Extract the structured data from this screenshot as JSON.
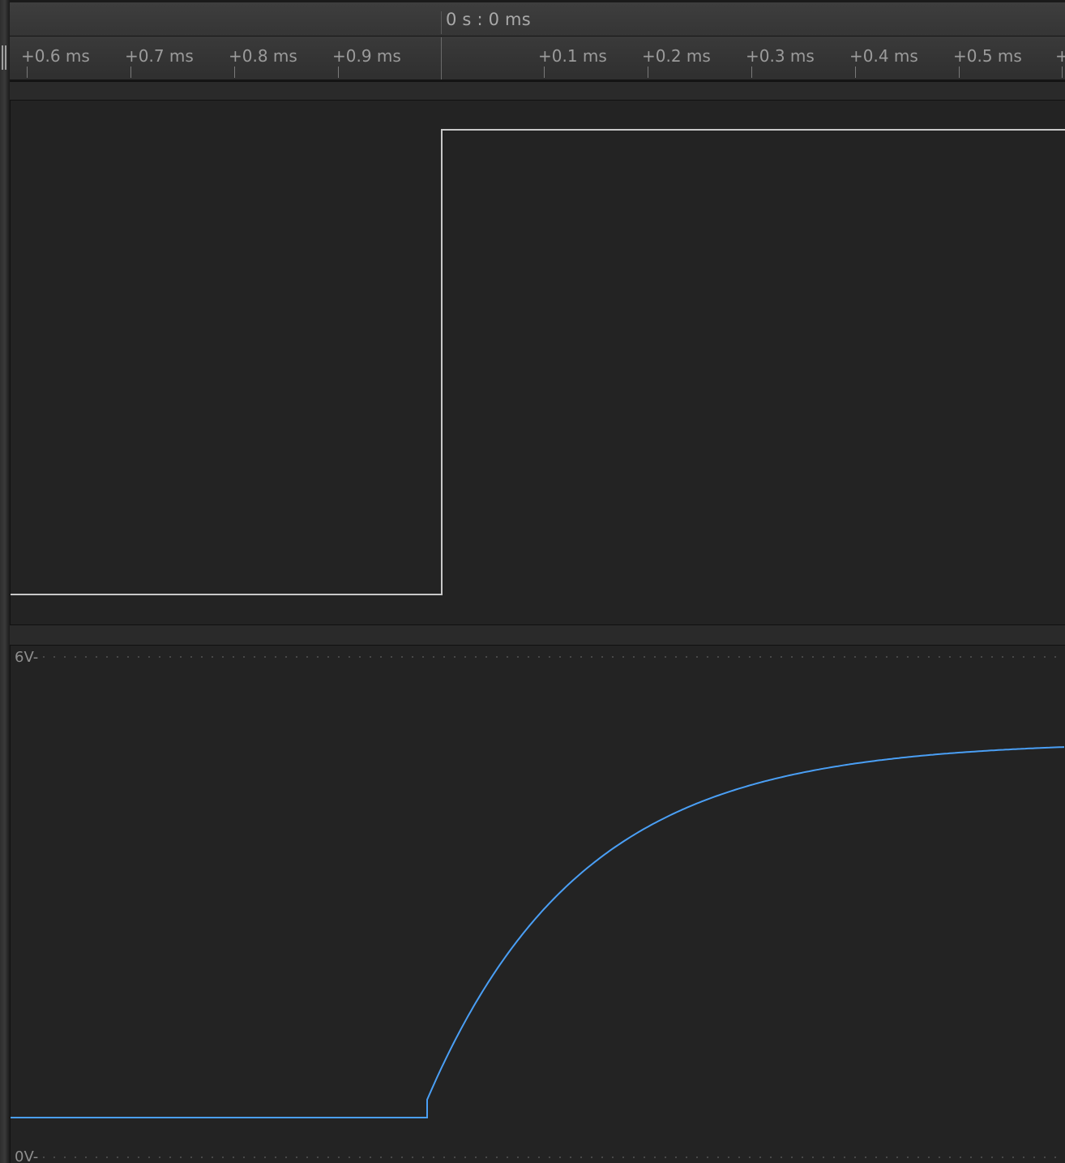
{
  "ruler": {
    "cursor_label": "0 s : 0 ms",
    "ticks": [
      "+0.6 ms",
      "+0.7 ms",
      "+0.8 ms",
      "+0.9 ms",
      "+0.1 ms",
      "+0.2 ms",
      "+0.3 ms",
      "+0.4 ms",
      "+0.5 ms",
      "+"
    ]
  },
  "digital_channel": {
    "color": "#c8c8c8",
    "transition": "low-to-high at 0 s : 0 ms"
  },
  "analog_channel": {
    "color": "#4a9ff5",
    "axis_top_label": "6V-",
    "axis_bottom_label": "0V-"
  },
  "colors": {
    "background": "#232323",
    "ruler": "#383838",
    "grid_dots": "#555555"
  },
  "icons": {
    "drag_handle": "grip-lines-icon"
  }
}
